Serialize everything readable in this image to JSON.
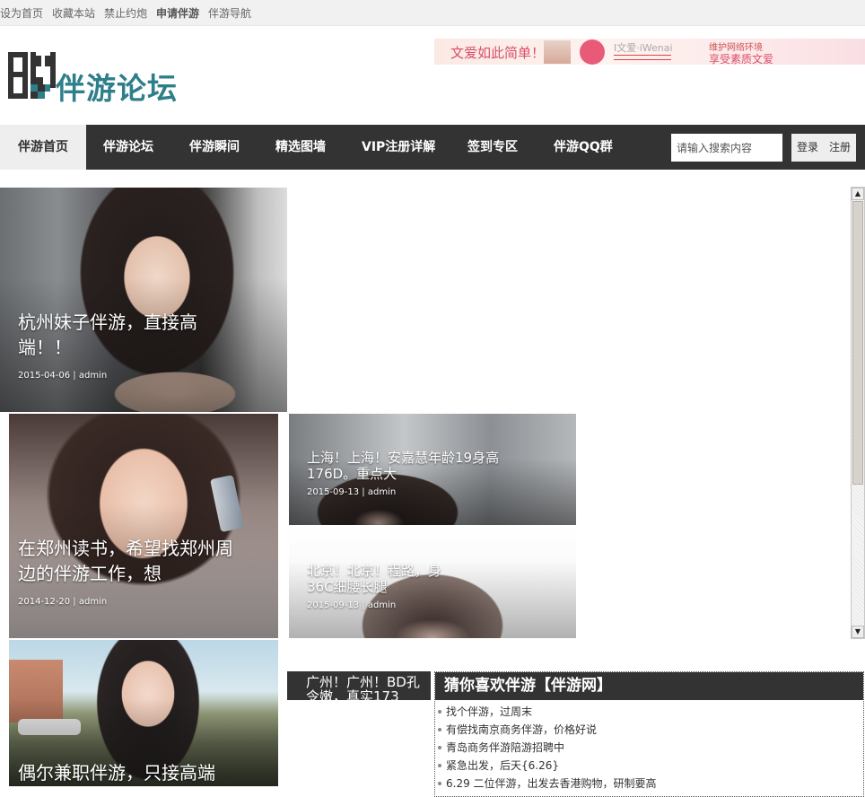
{
  "topbar": {
    "links": [
      "设为首页",
      "收藏本站",
      "禁止约炮",
      "申请伴游",
      "伴游导航"
    ]
  },
  "header": {
    "logo_text": "伴游论坛",
    "banner": {
      "slogan": "文爱如此简单！",
      "brand": "I文爱·iWenai",
      "tag1": "维护网络环境",
      "tag2": "享受素质文爱"
    }
  },
  "nav": {
    "items": [
      "伴游首页",
      "伴游论坛",
      "伴游瞬间",
      "精选图墙",
      "VIP注册详解",
      "签到专区",
      "伴游QQ群"
    ],
    "active_index": 0
  },
  "search": {
    "placeholder": "请输入搜索内容"
  },
  "auth": {
    "login": "登录",
    "register": "注册"
  },
  "posts": [
    {
      "title": "杭州妹子伴游，直接高端！！",
      "meta": "2015-04-06 | admin"
    },
    {
      "title": "在郑州读书，希望找郑州周边的伴游工作，想",
      "meta": "2014-12-20 | admin"
    },
    {
      "title": "上海！上海！安嘉慧年龄19身高176D。重点大",
      "meta": "2015-09-13 | admin"
    },
    {
      "title": "北京！北京！程路，身36C细腰长腿",
      "meta": "2015-09-13 | admin"
    },
    {
      "title": "偶尔兼职伴游，只接高端",
      "meta": ""
    }
  ],
  "dark_label": {
    "text": "广州！广州！BD孔令嫩，真实173"
  },
  "widget": {
    "title": "猜你喜欢伴游【伴游网】",
    "items": [
      "找个伴游，过周末",
      "有偿找南京商务伴游，价格好说",
      "青岛商务伴游陪游招聘中",
      "紧急出发，后天{6.26}",
      "6.29 二位伴游，出发去香港购物，研制要高"
    ]
  },
  "colors": {
    "nav_bg": "#333333",
    "logo_teal": "#2e7f8a",
    "topbar_bg": "#f1f1f1"
  }
}
